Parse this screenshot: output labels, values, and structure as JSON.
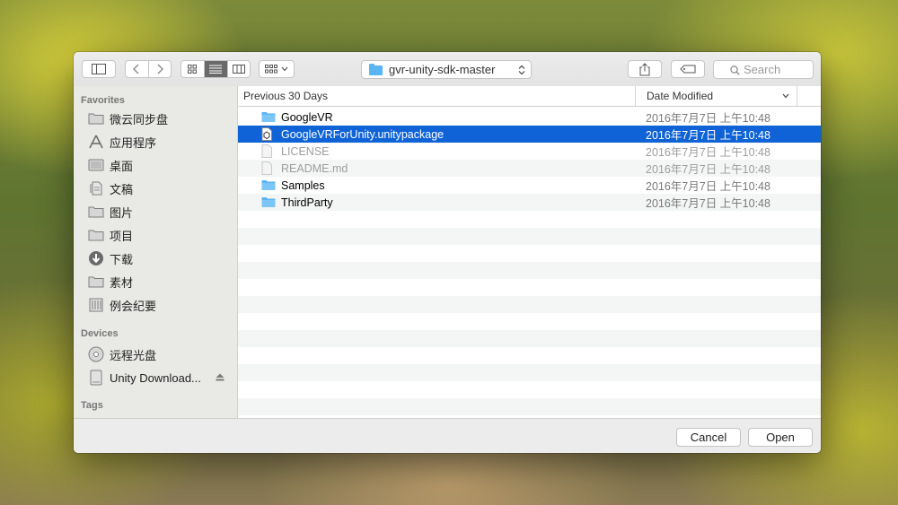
{
  "toolbar": {
    "current_folder": "gvr-unity-sdk-master",
    "search_placeholder": "Search"
  },
  "sidebar": {
    "favorites_header": "Favorites",
    "favorites": [
      {
        "label": "微云同步盘",
        "icon": "folder-icon"
      },
      {
        "label": "应用程序",
        "icon": "applications-icon"
      },
      {
        "label": "桌面",
        "icon": "desktop-icon"
      },
      {
        "label": "文稿",
        "icon": "documents-icon"
      },
      {
        "label": "图片",
        "icon": "folder-icon"
      },
      {
        "label": "项目",
        "icon": "folder-icon"
      },
      {
        "label": "下载",
        "icon": "downloads-icon"
      },
      {
        "label": "素材",
        "icon": "folder-icon"
      },
      {
        "label": "例会纪要",
        "icon": "archive-icon"
      }
    ],
    "devices_header": "Devices",
    "devices": [
      {
        "label": "远程光盘",
        "icon": "disc-icon"
      },
      {
        "label": "Unity Download...",
        "icon": "drive-icon"
      }
    ],
    "tags_header": "Tags"
  },
  "list": {
    "group_header": "Previous 30 Days",
    "date_column": "Date Modified",
    "rows": [
      {
        "name": "GoogleVR",
        "date": "2016年7月7日 上午10:48",
        "kind": "folder",
        "state": "normal"
      },
      {
        "name": "GoogleVRForUnity.unitypackage",
        "date": "2016年7月7日 上午10:48",
        "kind": "package",
        "state": "selected"
      },
      {
        "name": "LICENSE",
        "date": "2016年7月7日 上午10:48",
        "kind": "file",
        "state": "disabled"
      },
      {
        "name": "README.md",
        "date": "2016年7月7日 上午10:48",
        "kind": "file",
        "state": "disabled"
      },
      {
        "name": "Samples",
        "date": "2016年7月7日 上午10:48",
        "kind": "folder",
        "state": "normal"
      },
      {
        "name": "ThirdParty",
        "date": "2016年7月7日 上午10:48",
        "kind": "folder",
        "state": "normal"
      }
    ]
  },
  "footer": {
    "cancel_label": "Cancel",
    "open_label": "Open"
  },
  "colors": {
    "selection": "#0f63d6",
    "folder": "#5ab5f3"
  }
}
